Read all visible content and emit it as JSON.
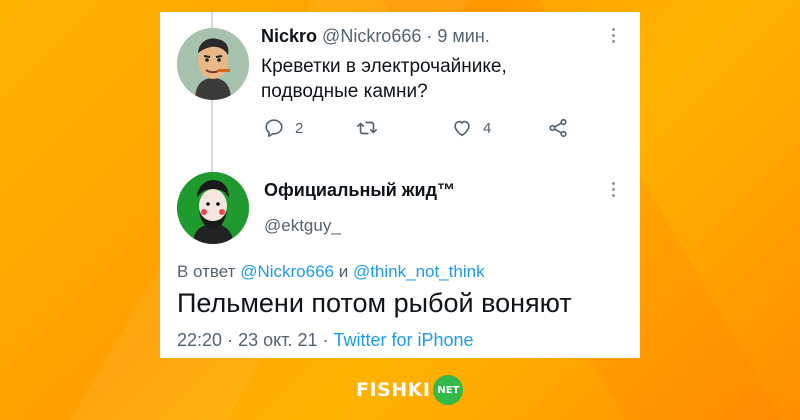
{
  "tweet1": {
    "author_name": "Nickro",
    "author_handle": "@Nickro666",
    "separator": "·",
    "time": "9 мин.",
    "text_line1": "Креветки в электрочайнике,",
    "text_line2": "подводные камни?",
    "actions": {
      "reply_count": "2",
      "retweet_count": "",
      "like_count": "4"
    }
  },
  "tweet2": {
    "author_name": "Официальный жид™",
    "author_handle": "@ektguy_",
    "reply_prefix": "В ответ",
    "reply_user1": "@Nickro666",
    "reply_and": "и",
    "reply_user2": "@think_not_think",
    "text": "Пельмени потом рыбой воняют",
    "time": "22:20",
    "sep1": "·",
    "date": "23 окт. 21",
    "sep2": "·",
    "source": "Twitter for iPhone"
  },
  "watermark": {
    "brand": "FISHKI",
    "badge": "NET"
  },
  "colors": {
    "link": "#1d9bf0",
    "secondary_text": "#536471",
    "background": "#ffa800",
    "logo_badge": "#35b84a"
  },
  "icons": [
    "reply-icon",
    "retweet-icon",
    "like-icon",
    "share-icon",
    "more-icon"
  ]
}
